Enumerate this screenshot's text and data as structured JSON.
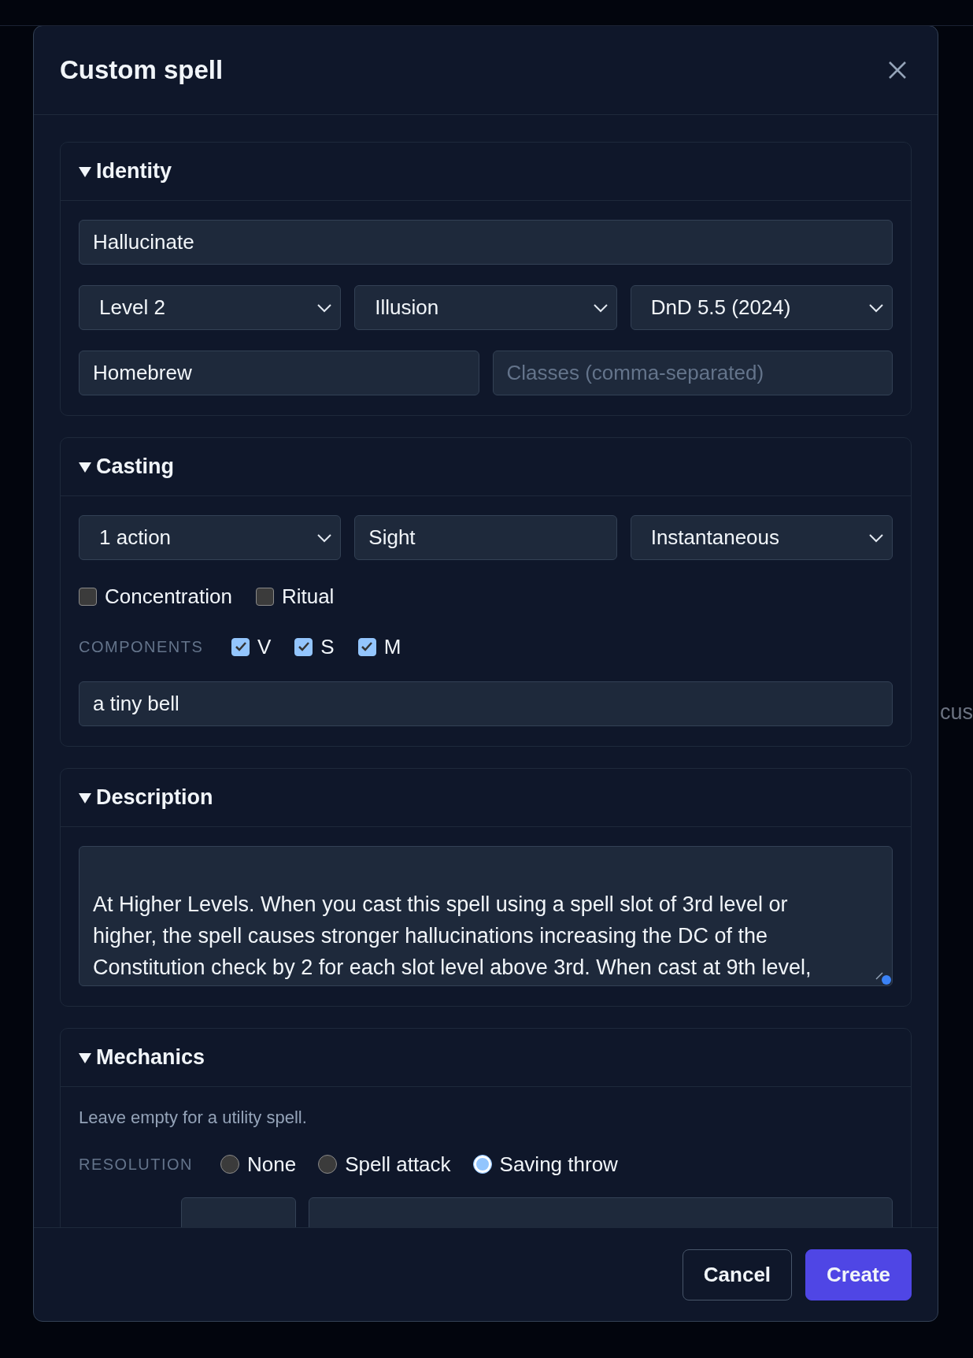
{
  "background_text": "cus",
  "dialog": {
    "title": "Custom spell"
  },
  "identity": {
    "title": "Identity",
    "expanded": true,
    "name": {
      "value": "Hallucinate"
    },
    "level": {
      "value": "Level 2"
    },
    "school": {
      "value": "Illusion"
    },
    "ruleset": {
      "value": "DnD 5.5 (2024)"
    },
    "source": {
      "value": "Homebrew"
    },
    "classes": {
      "placeholder": "Classes (comma-separated)"
    }
  },
  "casting": {
    "title": "Casting",
    "expanded": true,
    "casting_time": {
      "value": "1 action"
    },
    "range": {
      "value": "Sight"
    },
    "duration": {
      "value": "Instantaneous"
    },
    "flags": [
      {
        "label": "Concentration",
        "checked": false
      },
      {
        "label": "Ritual",
        "checked": false
      }
    ],
    "components_label": "COMPONENTS",
    "components": [
      {
        "label": "V",
        "checked": true
      },
      {
        "label": "S",
        "checked": true
      },
      {
        "label": "M",
        "checked": true
      }
    ],
    "material": {
      "value": "a tiny bell"
    }
  },
  "description": {
    "title": "Description",
    "expanded": true,
    "text": "At Higher Levels. When you cast this spell using a spell slot of 3rd level or higher, the spell causes stronger hallucinations increasing the DC of the Constitution check by 2 for each slot level above 3rd. When cast at 9th level,"
  },
  "mechanics": {
    "title": "Mechanics",
    "expanded": true,
    "note": "Leave empty for a utility spell.",
    "resolution_label": "RESOLUTION",
    "resolution_options": [
      {
        "label": "None",
        "selected": false
      },
      {
        "label": "Spell attack",
        "selected": false
      },
      {
        "label": "Saving throw",
        "selected": true
      }
    ]
  },
  "buttons": [
    {
      "label": "Cancel",
      "kind": "secondary"
    },
    {
      "label": "Create",
      "kind": "primary"
    }
  ]
}
